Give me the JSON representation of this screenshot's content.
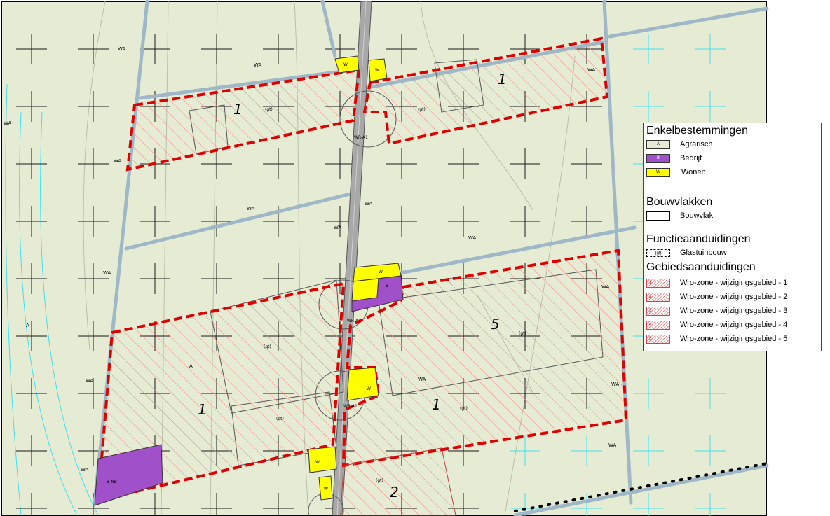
{
  "map_labels": {
    "zone_wa": "WA",
    "zone_a": "A",
    "zone_bnb": "B-NB",
    "gt": "(gt)",
    "wro": "WR-A1",
    "wonen_small": "W",
    "bedrijf_small": "B",
    "area_1": "1",
    "area_2": "2",
    "area_5": "5"
  },
  "legend": {
    "enkel_title": "Enkelbestemmingen",
    "agrarisch_code": "A",
    "agrarisch": "Agrarisch",
    "bedrijf_code": "B",
    "bedrijf": "Bedrijf",
    "wonen_code": "W",
    "wonen": "Wonen",
    "bouw_title": "Bouwvlakken",
    "bouwvlak": "Bouwvlak",
    "functie_title": "Functieaanduidingen",
    "glas_code": "(gt)",
    "glas": "Glastuinbouw",
    "gebied_title": "Gebiedsaanduidingen",
    "zones": [
      {
        "code": "1",
        "label": "Wro-zone - wijzigingsgebied - 1"
      },
      {
        "code": "2",
        "label": "Wro-zone - wijzigingsgebied - 2"
      },
      {
        "code": "3",
        "label": "Wro-zone - wijzigingsgebied - 3"
      },
      {
        "code": "4",
        "label": "Wro-zone - wijzigingsgebied - 4"
      },
      {
        "code": "5",
        "label": "Wro-zone - wijzigingsgebied - 5"
      }
    ]
  },
  "colors": {
    "agrarisch": "#e6ebd4",
    "wonen": "#ffff00",
    "bedrijf": "#a050c8",
    "wro_border": "#e00000",
    "hatch": "#f08080",
    "ditch": "#9fb8c8",
    "cyan_marks": "#40e0f0"
  }
}
